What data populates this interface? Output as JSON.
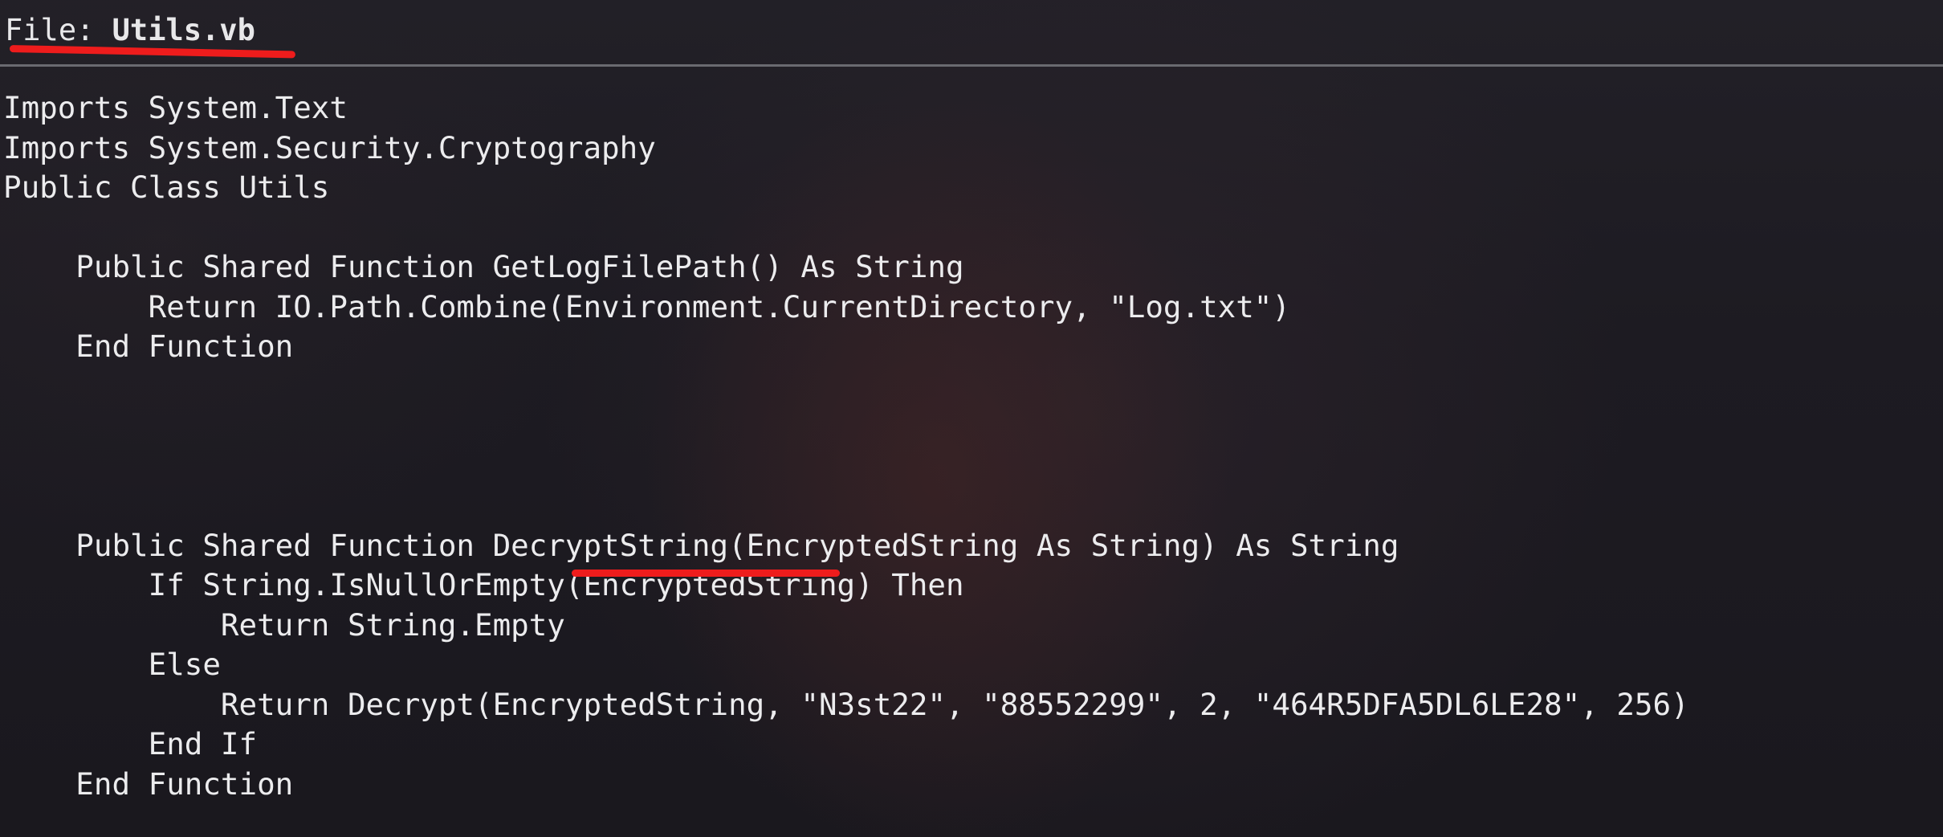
{
  "header": {
    "label": "File: ",
    "filename": "Utils.vb"
  },
  "code": {
    "lines": [
      "Imports System.Text",
      "Imports System.Security.Cryptography",
      "Public Class Utils",
      "",
      "    Public Shared Function GetLogFilePath() As String",
      "        Return IO.Path.Combine(Environment.CurrentDirectory, \"Log.txt\")",
      "    End Function",
      "",
      "",
      "",
      "",
      "    Public Shared Function DecryptString(EncryptedString As String) As String",
      "        If String.IsNullOrEmpty(EncryptedString) Then",
      "            Return String.Empty",
      "        Else",
      "            Return Decrypt(EncryptedString, \"N3st22\", \"88552299\", 2, \"464R5DFA5DL6LE28\", 256)",
      "        End If",
      "    End Function"
    ]
  },
  "colors": {
    "annotation_red": "#ee1c1c",
    "text": "#ececee",
    "background": "#1b1a20"
  }
}
